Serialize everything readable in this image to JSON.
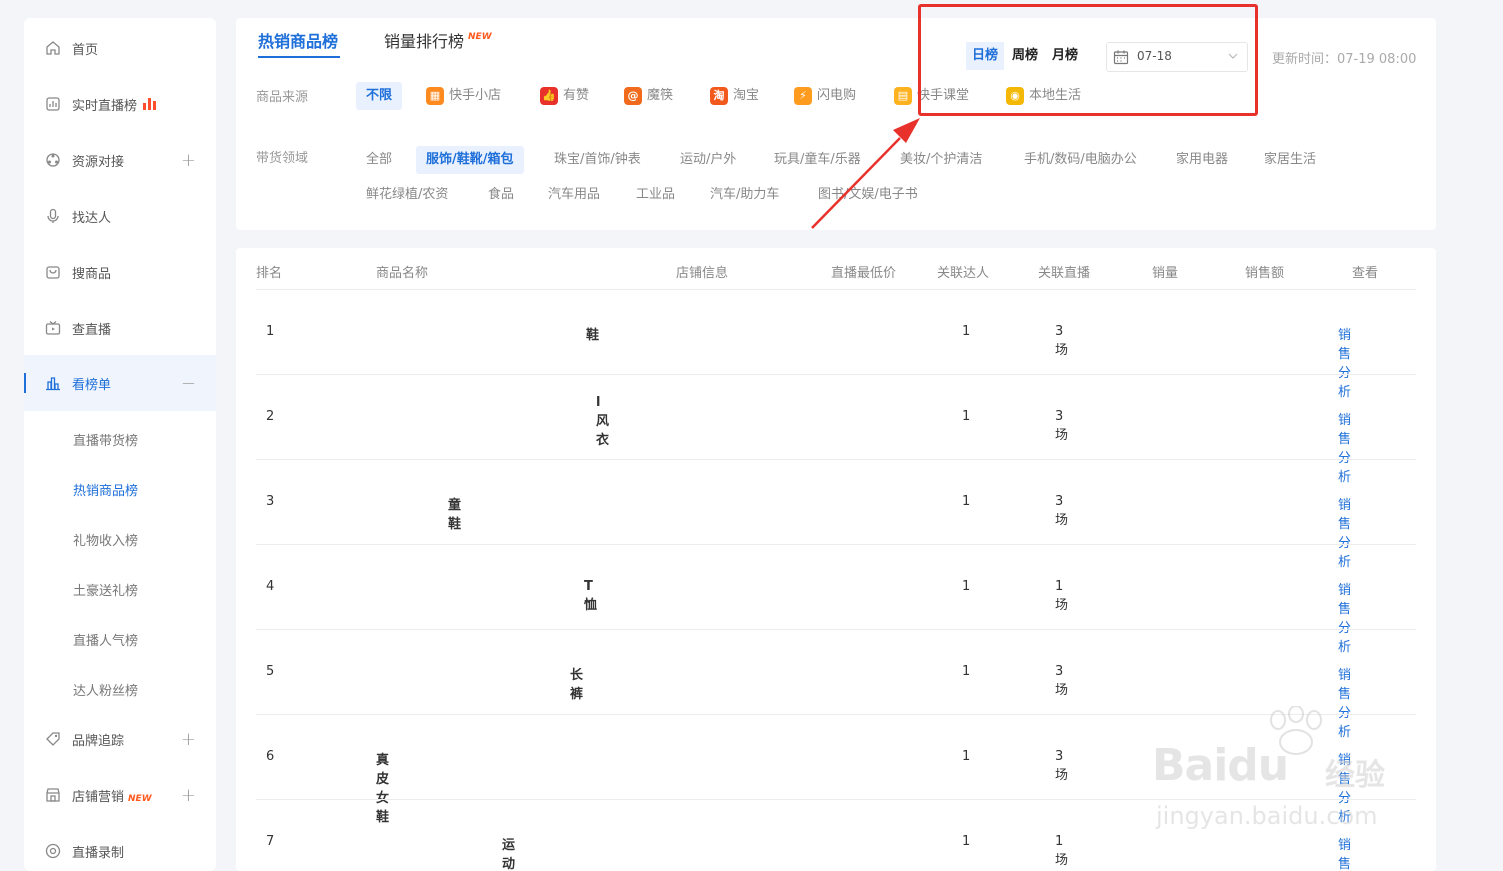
{
  "sidebar": {
    "items": [
      {
        "label": "首页",
        "icon": "home-icon"
      },
      {
        "label": "实时直播榜",
        "icon": "live-chart-icon"
      },
      {
        "label": "资源对接",
        "icon": "resource-icon",
        "expand": "+"
      },
      {
        "label": "找达人",
        "icon": "microphone-icon"
      },
      {
        "label": "搜商品",
        "icon": "bag-icon"
      },
      {
        "label": "查直播",
        "icon": "tv-icon"
      },
      {
        "label": "看榜单",
        "icon": "bar-chart-icon",
        "expand": "−"
      },
      {
        "label": "品牌追踪",
        "icon": "tag-icon",
        "expand": "+"
      },
      {
        "label": "店铺营销",
        "icon": "shop-icon",
        "badge": "NEW",
        "expand": "+"
      },
      {
        "label": "直播录制",
        "icon": "record-icon"
      }
    ],
    "subitems": [
      {
        "label": "直播带货榜"
      },
      {
        "label": "热销商品榜"
      },
      {
        "label": "礼物收入榜"
      },
      {
        "label": "土豪送礼榜"
      },
      {
        "label": "直播人气榜"
      },
      {
        "label": "达人粉丝榜"
      }
    ]
  },
  "tabs": [
    {
      "label": "热销商品榜"
    },
    {
      "label": "销量排行榜",
      "badge": "NEW"
    }
  ],
  "periods": [
    "日榜",
    "周榜",
    "月榜"
  ],
  "date": {
    "value": "07-18"
  },
  "update_time": "更新时间：07-19 08:00",
  "filters": {
    "source_label": "商品来源",
    "sources": [
      {
        "label": "不限"
      },
      {
        "label": "快手小店",
        "icon": "kuaishou-shop-icon",
        "color": "#ff8a1f"
      },
      {
        "label": "有赞",
        "icon": "youzan-icon",
        "color": "#e8312a"
      },
      {
        "label": "魔筷",
        "icon": "mokuai-icon",
        "color": "#f26b1d"
      },
      {
        "label": "淘宝",
        "icon": "taobao-icon",
        "color": "#f25a1d"
      },
      {
        "label": "闪电购",
        "icon": "shandiangou-icon",
        "color": "#ff9b1f"
      },
      {
        "label": "快手课堂",
        "icon": "classroom-icon",
        "color": "#ffb21f"
      },
      {
        "label": "本地生活",
        "icon": "location-icon",
        "color": "#f5b800"
      }
    ],
    "domain_label": "带货领域",
    "domains_row1": [
      "全部",
      "服饰/鞋靴/箱包",
      "珠宝/首饰/钟表",
      "运动/户外",
      "玩具/童车/乐器",
      "美妆/个护清洁",
      "手机/数码/电脑办公",
      "家用电器",
      "家居生活"
    ],
    "domains_row2": [
      "鲜花绿植/农资",
      "食品",
      "汽车用品",
      "工业品",
      "汽车/助力车",
      "图书/文娱/电子书"
    ]
  },
  "table": {
    "headers": [
      "排名",
      "商品名称",
      "店铺信息",
      "直播最低价",
      "关联达人",
      "关联直播",
      "销量",
      "销售额",
      "查看"
    ],
    "rows": [
      {
        "rank": "1",
        "name": "鞋",
        "kol": "1",
        "live": "3场",
        "action": "销售分析"
      },
      {
        "rank": "2",
        "name": "l风衣",
        "kol": "1",
        "live": "3场",
        "action": "销售分析"
      },
      {
        "rank": "3",
        "name": "童鞋",
        "kol": "1",
        "live": "3场",
        "action": "销售分析"
      },
      {
        "rank": "4",
        "name": "T恤",
        "kol": "1",
        "live": "1场",
        "action": "销售分析"
      },
      {
        "rank": "5",
        "name": "长裤",
        "kol": "1",
        "live": "3场",
        "action": "销售分析"
      },
      {
        "rank": "6",
        "name": "真皮女鞋",
        "kol": "1",
        "live": "3场",
        "action": "销售分析"
      },
      {
        "rank": "7",
        "name": "运动鞋",
        "kol": "1",
        "live": "1场",
        "action": "销售分析"
      }
    ]
  },
  "watermark": {
    "brand": "Baidu",
    "cn": "经验",
    "url": "jingyan.baidu.com"
  },
  "colors": {
    "accent": "#1e6fd9",
    "highlight": "#e8312a"
  }
}
